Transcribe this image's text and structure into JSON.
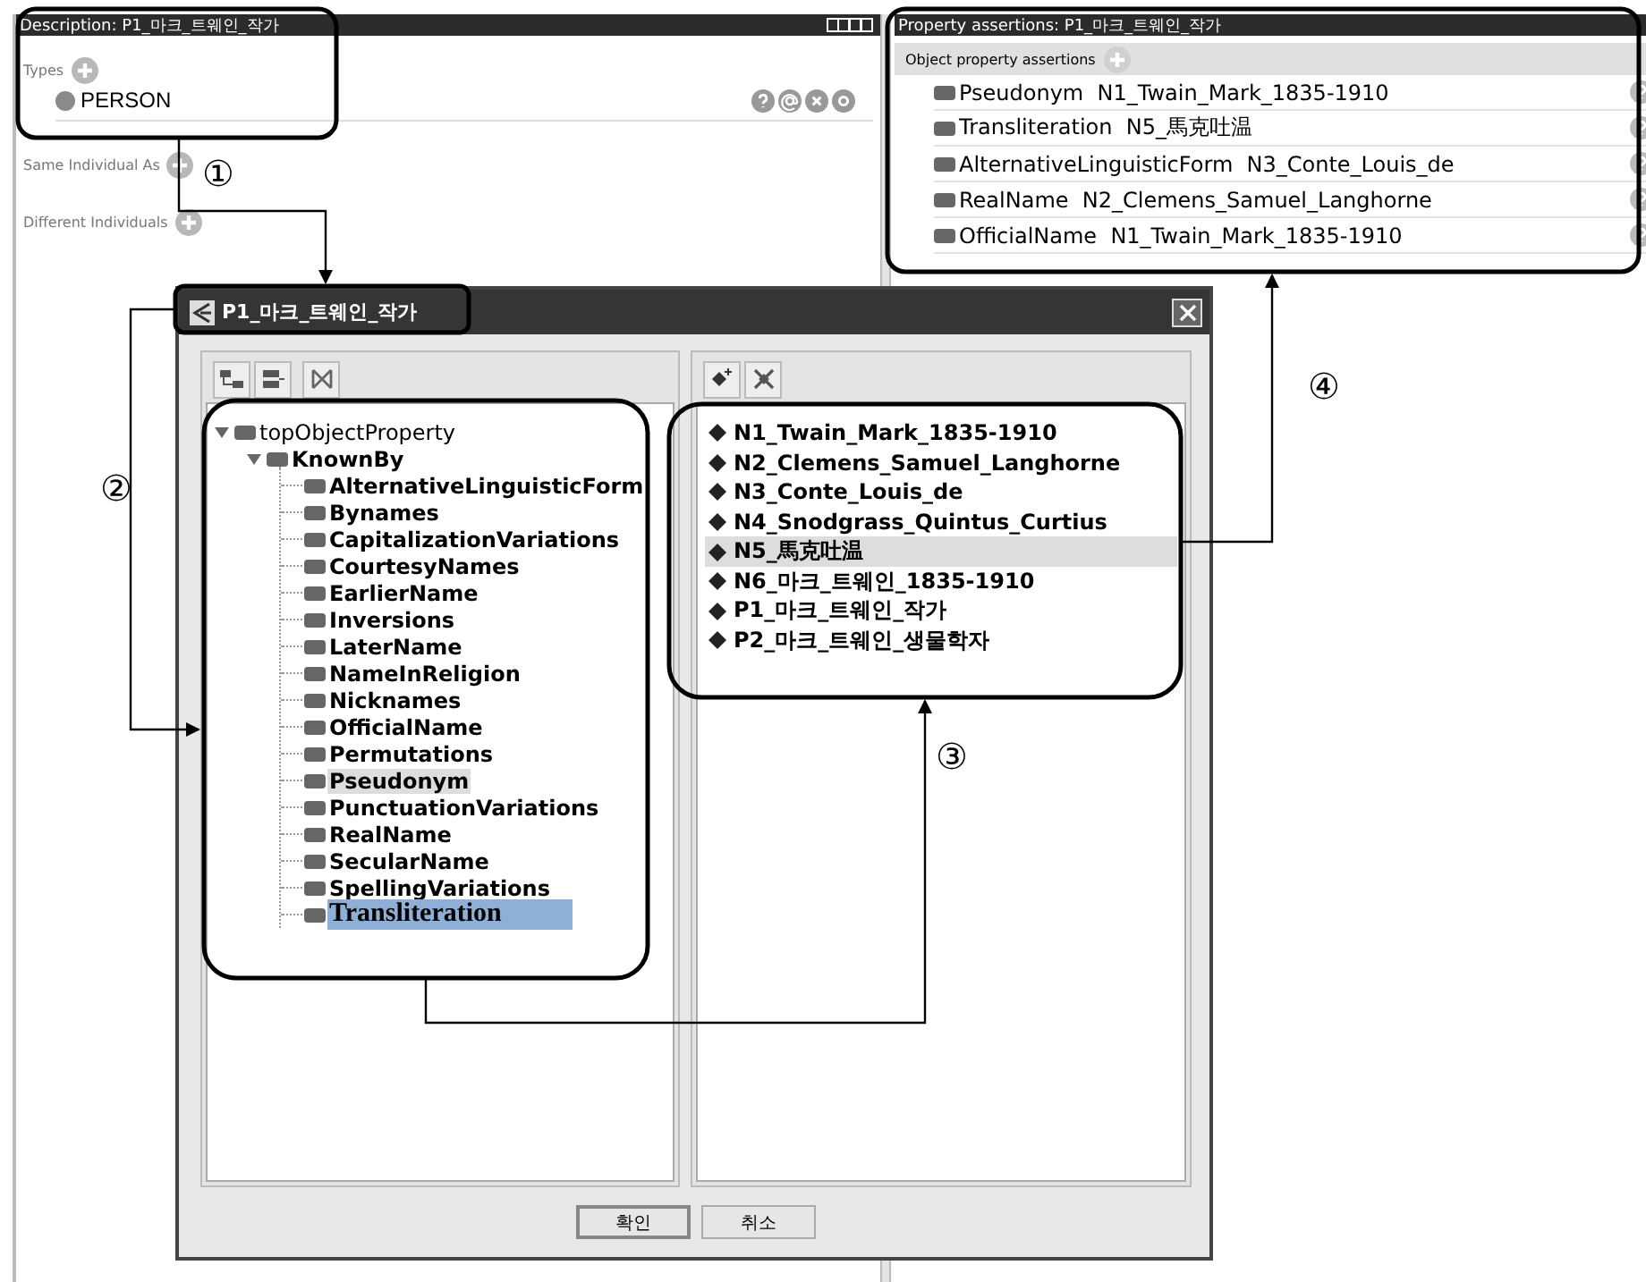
{
  "description_panel": {
    "title": "Description: P1_마크_트웨인_작가",
    "sections": [
      {
        "label": "Types",
        "items": [
          {
            "name": "PERSON"
          }
        ]
      },
      {
        "label": "Same Individual As"
      },
      {
        "label": "Different Individuals"
      }
    ]
  },
  "property_panel": {
    "title": "Property assertions: P1_마크_트웨인_작가",
    "section": "Object property assertions",
    "rows": [
      {
        "property": "Pseudonym",
        "value": "N1_Twain_Mark_1835-1910"
      },
      {
        "property": "Transliteration",
        "value": "N5_馬克吐温"
      },
      {
        "property": "AlternativeLinguisticForm",
        "value": "N3_Conte_Louis_de"
      },
      {
        "property": "RealName",
        "value": "N2_Clemens_Samuel_Langhorne"
      },
      {
        "property": "OfficialName",
        "value": "N1_Twain_Mark_1835-1910"
      }
    ]
  },
  "dialog": {
    "title": "P1_마크_트웨인_작가",
    "tree": [
      {
        "label": "topObjectProperty",
        "expanded": true,
        "children": [
          {
            "label": "KnownBy",
            "expanded": true,
            "children": [
              {
                "label": "AlternativeLinguisticForm",
                "selected": false,
                "highlighted": false
              },
              {
                "label": "Bynames",
                "selected": false,
                "highlighted": false
              },
              {
                "label": "CapitalizationVariations",
                "selected": false,
                "highlighted": false
              },
              {
                "label": "CourtesyNames",
                "selected": false,
                "highlighted": false
              },
              {
                "label": "EarlierName",
                "selected": false,
                "highlighted": false
              },
              {
                "label": "Inversions",
                "selected": false,
                "highlighted": false
              },
              {
                "label": "LaterName",
                "selected": false,
                "highlighted": false
              },
              {
                "label": "NameInReligion",
                "selected": false,
                "highlighted": false
              },
              {
                "label": "Nicknames",
                "selected": false,
                "highlighted": false
              },
              {
                "label": "OfficialName",
                "selected": false,
                "highlighted": false
              },
              {
                "label": "Permutations",
                "selected": false,
                "highlighted": false
              },
              {
                "label": "Pseudonym",
                "selected": false,
                "highlighted": true
              },
              {
                "label": "PunctuationVariations",
                "selected": false,
                "highlighted": false
              },
              {
                "label": "RealName",
                "selected": false,
                "highlighted": false
              },
              {
                "label": "SecularName",
                "selected": false,
                "highlighted": false
              },
              {
                "label": "SpellingVariations",
                "selected": false,
                "highlighted": false
              },
              {
                "label": "Transliteration",
                "selected": true,
                "highlighted": false
              }
            ]
          }
        ]
      }
    ],
    "individuals": [
      {
        "label": "N1_Twain_Mark_1835-1910",
        "selected": false
      },
      {
        "label": "N2_Clemens_Samuel_Langhorne",
        "selected": false
      },
      {
        "label": "N3_Conte_Louis_de",
        "selected": false
      },
      {
        "label": "N4_Snodgrass_Quintus_Curtius",
        "selected": false
      },
      {
        "label": "N5_馬克吐温",
        "selected": true
      },
      {
        "label": "N6_마크_트웨인_1835-1910",
        "selected": false
      },
      {
        "label": "P1_마크_트웨인_작가",
        "selected": false
      },
      {
        "label": "P2_마크_트웨인_생물학자",
        "selected": false
      }
    ],
    "buttons": [
      "확인",
      "취소"
    ]
  },
  "callouts": [
    "①",
    "②",
    "③",
    "④"
  ]
}
